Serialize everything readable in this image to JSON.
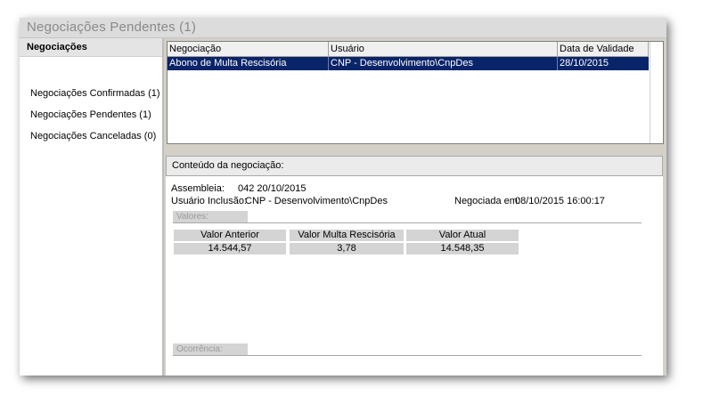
{
  "window": {
    "title": "Negociações Pendentes (1)"
  },
  "sidebar": {
    "header": "Negociações",
    "items": [
      {
        "label": "Negociações Confirmadas (1)"
      },
      {
        "label": "Negociações Pendentes (1)"
      },
      {
        "label": "Negociações Canceladas (0)"
      }
    ]
  },
  "grid": {
    "columns": [
      "Negociação",
      "Usuário",
      "Data de Validade"
    ],
    "rows": [
      {
        "negociacao": "Abono de Multa Rescisória",
        "usuario": "CNP - Desenvolvimento\\CnpDes",
        "data": "28/10/2015"
      }
    ]
  },
  "content": {
    "header": "Conteúdo da negociação:",
    "assembleia_label": "Assembleia:",
    "assembleia_value": "042  20/10/2015",
    "usuario_label": "Usuário Inclusão:",
    "usuario_value": "CNP - Desenvolvimento\\CnpDes",
    "negociada_label": "Negociada em:",
    "negociada_value": "08/10/2015 16:00:17",
    "valores_label": "Valores:",
    "valores_headers": [
      "Valor Anterior",
      "Valor Multa Rescisória",
      "Valor Atual"
    ],
    "valores_values": [
      "14.544,57",
      "3,78",
      "14.548,35"
    ],
    "ocorrencia_label": "Ocorrência:"
  }
}
